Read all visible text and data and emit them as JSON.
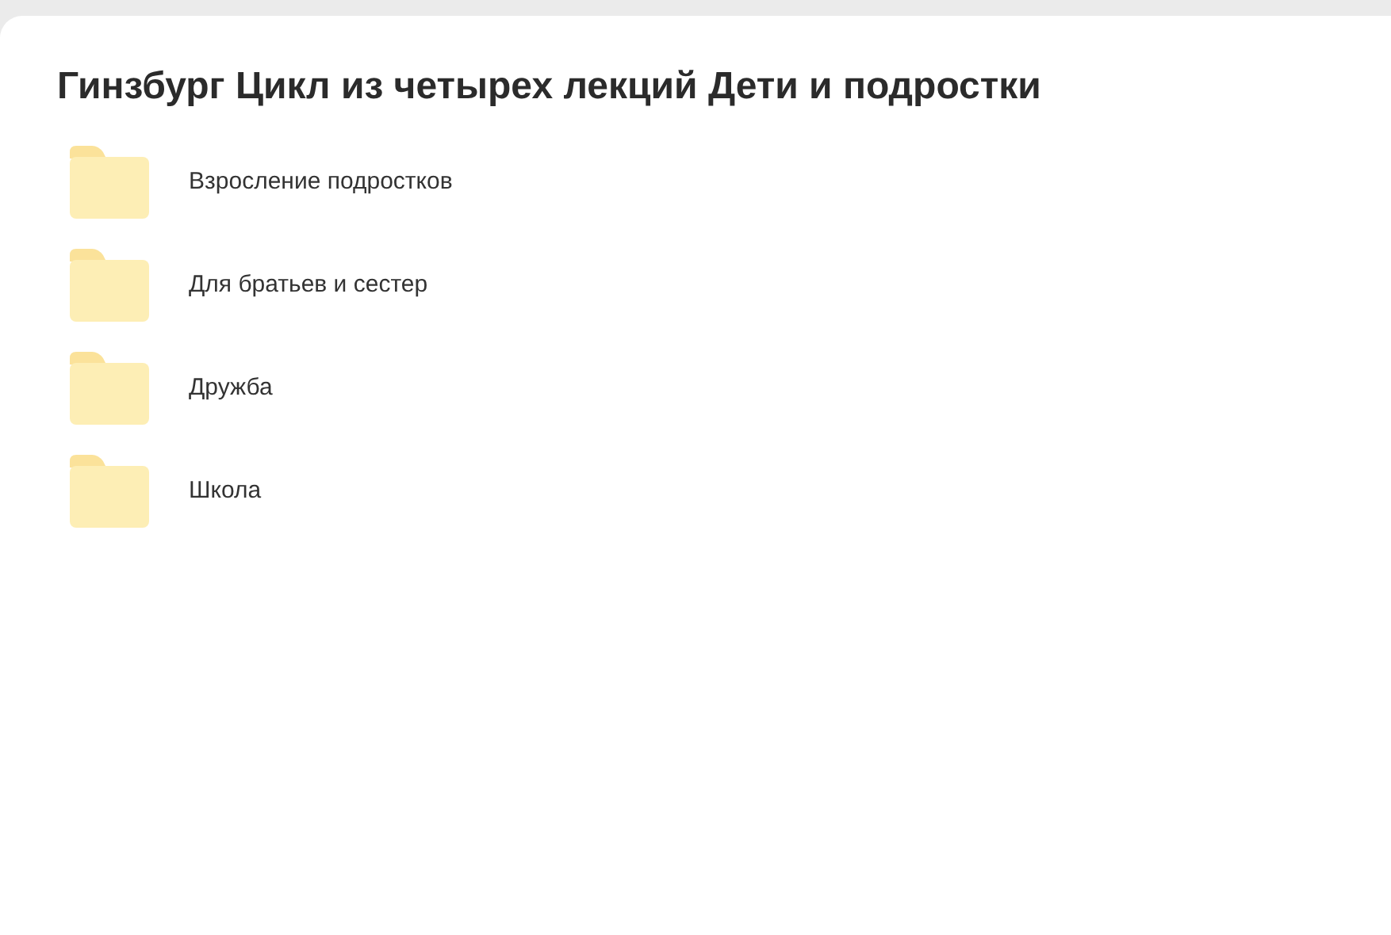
{
  "title": "Гинзбург Цикл из четырех лекций Дети и подростки",
  "folders": [
    {
      "name": "Взросление подростков"
    },
    {
      "name": "Для братьев и сестер"
    },
    {
      "name": "Дружба"
    },
    {
      "name": "Школа"
    }
  ]
}
